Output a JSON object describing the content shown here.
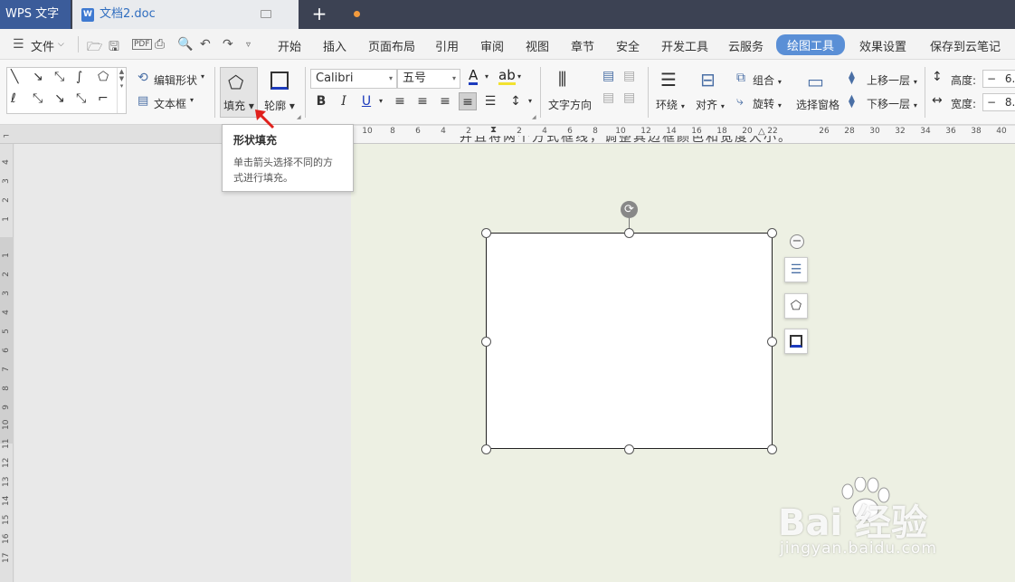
{
  "titlebar": {
    "app_name": "WPS 文字",
    "doc_tab": "文档2.doc",
    "new_tab_symbol": "+"
  },
  "menubar": {
    "file_label": "文件",
    "items": [
      "开始",
      "插入",
      "页面布局",
      "引用",
      "审阅",
      "视图",
      "章节",
      "安全",
      "开发工具",
      "云服务",
      "绘图工具",
      "效果设置",
      "保存到云笔记"
    ],
    "active": "绘图工具"
  },
  "ribbon": {
    "edit_shape": "编辑形状",
    "text_box": "文本框",
    "fill": "填充",
    "outline": "轮廓",
    "font_name": "Calibri",
    "font_size": "五号",
    "text_direction": "文字方向",
    "wrap": "环绕",
    "align": "对齐",
    "group": "组合",
    "rotate": "旋转",
    "selection_pane": "选择窗格",
    "bring_forward": "上移一层",
    "send_backward": "下移一层",
    "height_label": "高度:",
    "width_label": "宽度:",
    "height_value": "6.",
    "width_value": "8.",
    "stepper_minus": "−"
  },
  "ruler": {
    "h_ticks": [
      "10",
      "8",
      "6",
      "4",
      "2",
      "2",
      "4",
      "6",
      "8",
      "10",
      "12",
      "14",
      "16",
      "18",
      "20",
      "22",
      "26",
      "28",
      "30",
      "32",
      "34",
      "36",
      "38",
      "40"
    ],
    "v_ticks_top": [
      "4",
      "3",
      "2",
      "1"
    ],
    "v_ticks_bottom": [
      "1",
      "2",
      "3",
      "4",
      "5",
      "6",
      "7",
      "8",
      "9",
      "10",
      "11",
      "12",
      "13",
      "14",
      "15",
      "16",
      "17"
    ]
  },
  "tooltip": {
    "title": "形状填充",
    "description": "单击箭头选择不同的方式进行填充。"
  },
  "page_text_partial": "并且将两个方式框线，调整其边框颜色和宽度大小。",
  "watermark": {
    "brand": "Bai  经验",
    "url": "jingyan.baidu.com"
  },
  "colors": {
    "titlebar": "#3c4253",
    "app_tab": "#3b5c9a",
    "active_menu": "#5a8fd6",
    "page_bg": "#edf0e3",
    "arrow": "#e0201c"
  }
}
